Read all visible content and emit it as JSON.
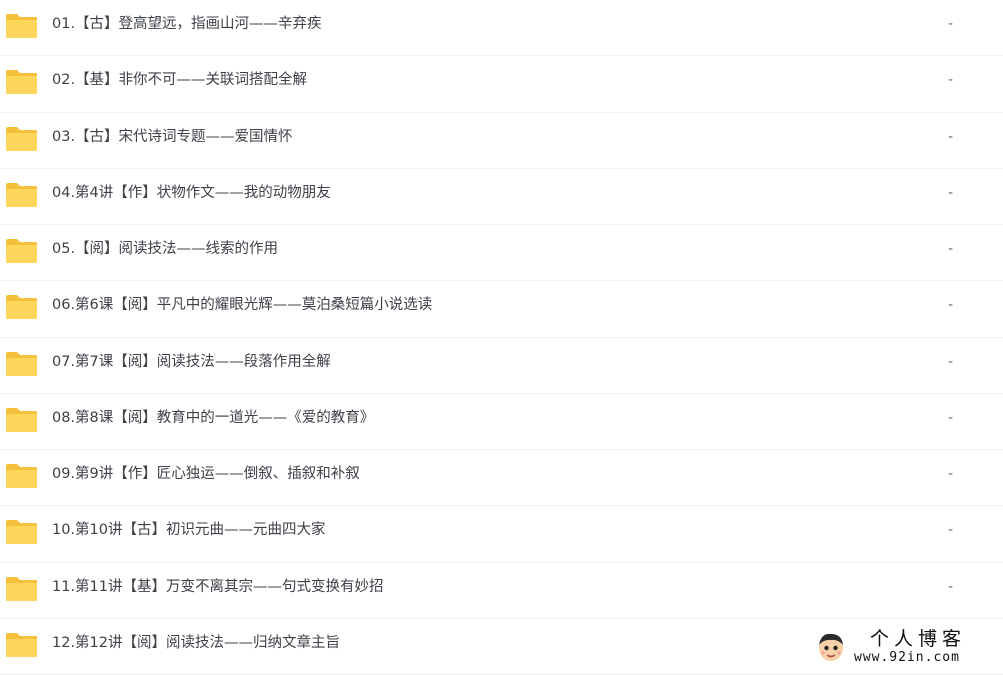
{
  "file_list": {
    "items": [
      {
        "name": "01.【古】登高望远，指画山河——辛弃疾",
        "size": "-",
        "icon": "folder-icon"
      },
      {
        "name": "02.【基】非你不可——关联词搭配全解",
        "size": "-",
        "icon": "folder-icon"
      },
      {
        "name": "03.【古】宋代诗词专题——爱国情怀",
        "size": "-",
        "icon": "folder-icon"
      },
      {
        "name": "04.第4讲【作】状物作文——我的动物朋友",
        "size": "-",
        "icon": "folder-icon"
      },
      {
        "name": "05.【阅】阅读技法——线索的作用",
        "size": "-",
        "icon": "folder-icon"
      },
      {
        "name": "06.第6课【阅】平凡中的耀眼光辉——莫泊桑短篇小说选读",
        "size": "-",
        "icon": "folder-icon"
      },
      {
        "name": "07.第7课【阅】阅读技法——段落作用全解",
        "size": "-",
        "icon": "folder-icon"
      },
      {
        "name": "08.第8课【阅】教育中的一道光——《爱的教育》",
        "size": "-",
        "icon": "folder-icon"
      },
      {
        "name": "09.第9讲【作】匠心独运——倒叙、插叙和补叙",
        "size": "-",
        "icon": "folder-icon"
      },
      {
        "name": "10.第10讲【古】初识元曲——元曲四大家",
        "size": "-",
        "icon": "folder-icon"
      },
      {
        "name": "11.第11讲【基】万变不离其宗——句式变换有妙招",
        "size": "-",
        "icon": "folder-icon"
      },
      {
        "name": "12.第12讲【阅】阅读技法——归纳文章主旨",
        "size": "-",
        "icon": "folder-icon"
      }
    ]
  },
  "watermark": {
    "title": "个人博客",
    "url": "www.92in.com",
    "icon": "cartoon-avatar-icon"
  },
  "colors": {
    "folder_body": "#ffd65c",
    "folder_tab": "#f5c13d",
    "text": "#3d4148",
    "row_divider": "#f1f2f4"
  }
}
